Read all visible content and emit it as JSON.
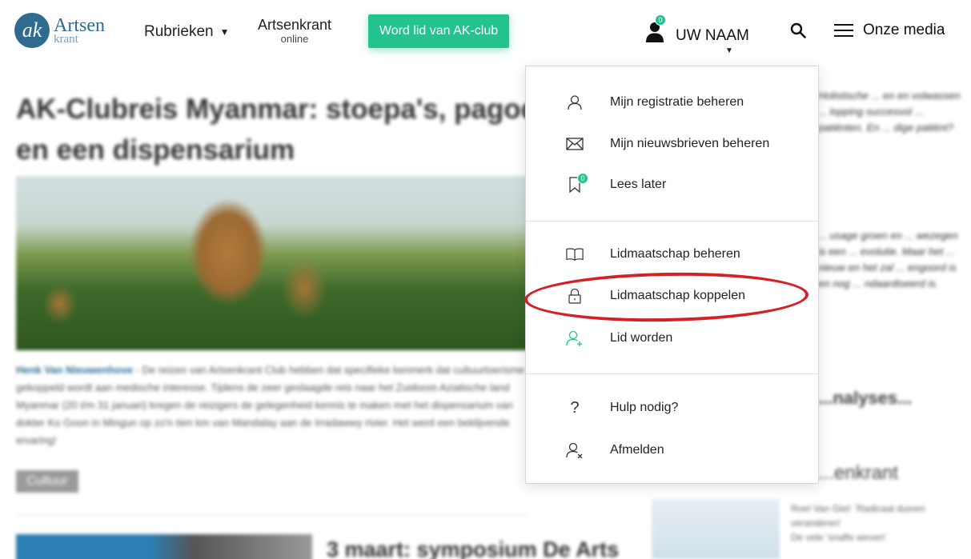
{
  "header": {
    "logo": {
      "monogram": "ak",
      "word1": "Artsen",
      "word2": "krant"
    },
    "nav_rubrieken": "Rubrieken",
    "nav_artsenkrant": {
      "line1": "Artsenkrant",
      "line2": "online"
    },
    "cta_button": "Word lid van AK-club",
    "user": {
      "name": "UW NAAM",
      "badge": "0"
    },
    "menu_label": "Onze media"
  },
  "background": {
    "article_title": "AK-Clubreis Myanmar: stoepa's, pagodes en een dispensarium",
    "article_author": "Henk Van Nieuwenhove",
    "article_text": " - De reizen van Artsenkrant Club hebben dat specifieke kenmerk dat cultuurtoerisme gekoppeld wordt aan medische interesse. Tijdens de zeer geslaagde reis naar het Zuidoost-Aziatische land Myanmar (20 t/m 31 januari) kregen de reizigers de gelegenheid kennis te maken met het dispensarium van dokter Ko Goon in Mingun op zo'n tien km van Mandalay aan de Irradawwy rivier. Het werd een beklijvende ervaring!",
    "article_tag": "Cultuur",
    "article2_title": "3 maart: symposium De Arts",
    "side_text_1": "Holistische ... en en volwassen ... lopping succesvol ... patiënten. En ... dige patiënt?",
    "side_text_2": "... usage groen en ... wezegen is een ... evolutie. Maar het ... nieuw en het zal ... engoord is en nog ... ndaardiseerd is.",
    "side_analyses": "...nalyses...",
    "side_heading": "...enkrant",
    "side_list": [
      "Roel Van Giel: 'Radicaal duiven veranderen'",
      "De vele 'snaffe weven'"
    ]
  },
  "dropdown": {
    "items": [
      {
        "label": "Mijn registratie beheren",
        "icon": "user-outline-icon"
      },
      {
        "label": "Mijn nieuwsbrieven beheren",
        "icon": "envelope-icon"
      },
      {
        "label": "Lees later",
        "icon": "bookmark-icon",
        "badge": "0"
      },
      {
        "label": "Lidmaatschap beheren",
        "icon": "book-icon"
      },
      {
        "label": "Lidmaatschap koppelen",
        "icon": "lock-icon"
      },
      {
        "label": "Lid worden",
        "icon": "user-plus-icon"
      },
      {
        "label": "Hulp nodig?",
        "icon": "question-icon"
      },
      {
        "label": "Afmelden",
        "icon": "user-x-icon"
      }
    ]
  },
  "colors": {
    "brand": "#2f6a8f",
    "accent": "#22c38e",
    "highlight": "#d42027"
  }
}
